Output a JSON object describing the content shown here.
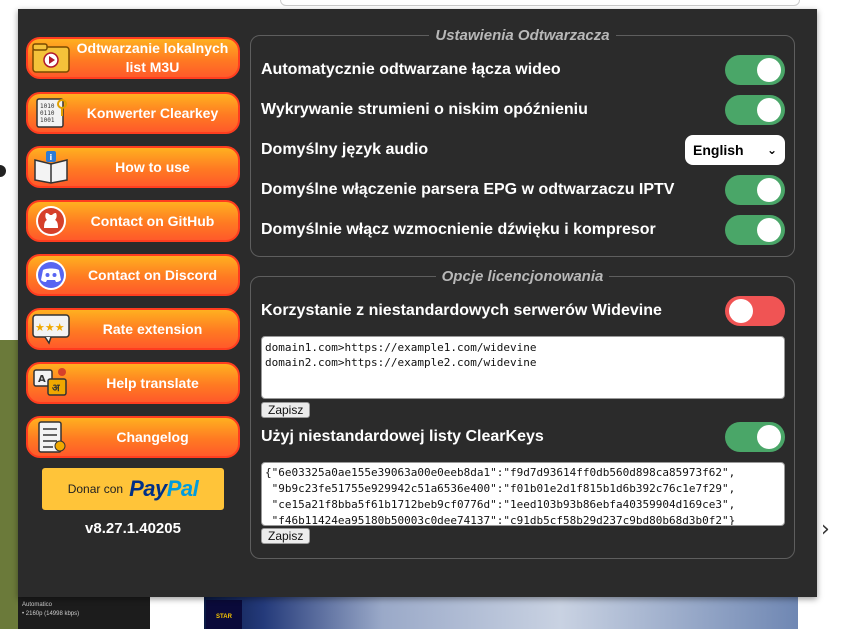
{
  "sidebar": {
    "buttons": [
      {
        "label": "Odtwarzanie lokalnych list M3U",
        "icon": "folder-play-icon"
      },
      {
        "label": "Konwerter Clearkey",
        "icon": "binary-key-icon"
      },
      {
        "label": "How to use",
        "icon": "info-book-icon"
      },
      {
        "label": "Contact on GitHub",
        "icon": "github-icon"
      },
      {
        "label": "Contact on Discord",
        "icon": "discord-icon"
      },
      {
        "label": "Rate extension",
        "icon": "star-rating-icon"
      },
      {
        "label": "Help translate",
        "icon": "translate-icon"
      },
      {
        "label": "Changelog",
        "icon": "checklist-icon"
      }
    ],
    "paypal": {
      "prefix": "Donar con",
      "logo_a": "Pay",
      "logo_b": "Pal"
    },
    "version": "v8.27.1.40205"
  },
  "player_settings": {
    "title": "Ustawienia Odtwarzacza",
    "items": [
      {
        "label": "Automatycznie odtwarzane łącza wideo",
        "state": "on"
      },
      {
        "label": "Wykrywanie strumieni o niskim opóźnieniu",
        "state": "on"
      },
      {
        "label": "Domyślny język audio",
        "select": "English"
      },
      {
        "label": "Domyślne włączenie parsera EPG w odtwarzaczu IPTV",
        "state": "on"
      },
      {
        "label": "Domyślnie włącz wzmocnienie dźwięku i kompresor",
        "state": "on"
      }
    ]
  },
  "license": {
    "title": "Opcje licencjonowania",
    "widevine_label": "Korzystanie z niestandardowych serwerów Widevine",
    "widevine_state": "off",
    "widevine_text": "domain1.com>https://example1.com/widevine\ndomain2.com>https://example2.com/widevine",
    "save_label": "Zapisz",
    "clearkeys_label": "Użyj niestandardowej listy ClearKeys",
    "clearkeys_state": "on",
    "clearkeys_text": "{\"6e03325a0ae155e39063a00e0eeb8da1\":\"f9d7d93614ff0db560d898ca85973f62\",\n \"9b9c23fe51755e929942c51a6536e400\":\"f01b01e2d1f815b1d6b392c76c1e7f29\",\n \"ce15a21f8bba5f61b1712beb9cf0776d\":\"1eed103b93b86ebfa40359904d169ce3\",\n \"f46b11424ea95180b50003c0dee74137\":\"c91db5cf58b29d237c9bd80b68d3b0f2\"}",
    "save_label_2": "Zapisz"
  },
  "background": {
    "video_info": "Automatico\n• 2160p (14998 kbps)",
    "badge": "STAR"
  },
  "colors": {
    "toggle_on": "#4aa668",
    "toggle_off": "#f05454",
    "accent": "#ff7a22",
    "popup_bg": "#2b2b2b"
  }
}
